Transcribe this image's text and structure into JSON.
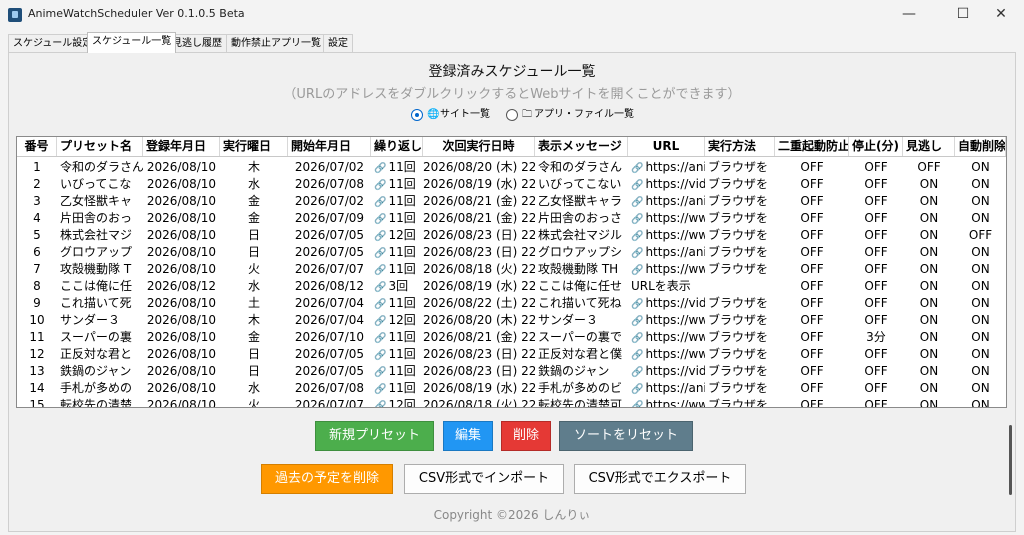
{
  "window": {
    "title": "AnimeWatchScheduler Ver 0.1.0.5 Beta",
    "minimize_glyph": "—",
    "maximize_glyph": "☐",
    "close_glyph": "✕"
  },
  "tabs": [
    "スケジュール設定",
    "スケジュール一覧",
    "見逃し履歴",
    "動作禁止アプリ一覧",
    "設定"
  ],
  "active_tab": 1,
  "heading": "登録済みスケジュール一覧",
  "subheading": "（URLのアドレスをダブルクリックするとWebサイトを開くことができます）",
  "view_options": {
    "site_list": "サイト一覧",
    "app_file_list": "アプリ・ファイル一覧",
    "selected": "site_list"
  },
  "table": {
    "columns": [
      "番号",
      "プリセット名",
      "登録年月日",
      "実行曜日",
      "開始年月日",
      "繰り返し回数",
      "次回実行日時",
      "表示メッセージ",
      "URL",
      "実行方法",
      "二重起動防止",
      "停止(分)",
      "見逃し",
      "自動削除"
    ],
    "rows": [
      [
        "1",
        "令和のダラさん",
        "2026/08/10",
        "木",
        "2026/07/02",
        "11回",
        "2026/08/20 (木) 22",
        "令和のダラさん",
        "https://ani",
        "ブラウザを",
        "OFF",
        "OFF",
        "OFF",
        "ON"
      ],
      [
        "2",
        "いびってこな",
        "2026/08/10",
        "水",
        "2026/07/08",
        "11回",
        "2026/08/19 (水) 22",
        "いびってこない",
        "https://vid",
        "ブラウザを",
        "OFF",
        "OFF",
        "ON",
        "ON"
      ],
      [
        "3",
        "乙女怪獣キャ",
        "2026/08/10",
        "金",
        "2026/07/02",
        "11回",
        "2026/08/21 (金) 22",
        "乙女怪獣キャラ",
        "https://ani",
        "ブラウザを",
        "OFF",
        "OFF",
        "ON",
        "ON"
      ],
      [
        "4",
        "片田舎のおっ",
        "2026/08/10",
        "金",
        "2026/07/09",
        "11回",
        "2026/08/21 (金) 22",
        "片田舎のおっさ",
        "https://ww",
        "ブラウザを",
        "OFF",
        "OFF",
        "ON",
        "ON"
      ],
      [
        "5",
        "株式会社マジ",
        "2026/08/10",
        "日",
        "2026/07/05",
        "12回",
        "2026/08/23 (日) 22",
        "株式会社マジル",
        "https://ww",
        "ブラウザを",
        "OFF",
        "OFF",
        "ON",
        "OFF"
      ],
      [
        "6",
        "グロウアップ",
        "2026/08/10",
        "日",
        "2026/07/05",
        "11回",
        "2026/08/23 (日) 22",
        "グロウアップシ",
        "https://ani",
        "ブラウザを",
        "OFF",
        "OFF",
        "ON",
        "ON"
      ],
      [
        "7",
        "攻殻機動隊 T",
        "2026/08/10",
        "火",
        "2026/07/07",
        "11回",
        "2026/08/18 (火) 22",
        "攻殻機動隊 TH",
        "https://ww",
        "ブラウザを",
        "OFF",
        "OFF",
        "ON",
        "ON"
      ],
      [
        "8",
        "ここは俺に任",
        "2026/08/12",
        "水",
        "2026/08/12",
        "3回",
        "2026/08/19 (水) 22",
        "ここは俺に任せ",
        "URLを表示",
        "",
        "OFF",
        "OFF",
        "ON",
        "ON"
      ],
      [
        "9",
        "これ描いて死",
        "2026/08/10",
        "土",
        "2026/07/04",
        "11回",
        "2026/08/22 (土) 22",
        "これ描いて死ね",
        "https://vid",
        "ブラウザを",
        "OFF",
        "OFF",
        "ON",
        "ON"
      ],
      [
        "10",
        "サンダー３",
        "2026/08/10",
        "木",
        "2026/07/04",
        "12回",
        "2026/08/20 (木) 22",
        "サンダー３",
        "https://ww",
        "ブラウザを",
        "OFF",
        "OFF",
        "ON",
        "ON"
      ],
      [
        "11",
        "スーパーの裏",
        "2026/08/10",
        "金",
        "2026/07/10",
        "11回",
        "2026/08/21 (金) 22",
        "スーパーの裏で",
        "https://ww",
        "ブラウザを",
        "OFF",
        "3分",
        "ON",
        "ON"
      ],
      [
        "12",
        "正反対な君と",
        "2026/08/10",
        "日",
        "2026/07/05",
        "11回",
        "2026/08/23 (日) 22",
        "正反対な君と僕",
        "https://ww",
        "ブラウザを",
        "OFF",
        "OFF",
        "ON",
        "ON"
      ],
      [
        "13",
        "鉄鍋のジャン",
        "2026/08/10",
        "日",
        "2026/07/05",
        "11回",
        "2026/08/23 (日) 22",
        "鉄鍋のジャン",
        "https://vid",
        "ブラウザを",
        "OFF",
        "OFF",
        "ON",
        "ON"
      ],
      [
        "14",
        "手札が多めの",
        "2026/08/10",
        "水",
        "2026/07/08",
        "11回",
        "2026/08/19 (水) 22",
        "手札が多めのビ",
        "https://ani",
        "ブラウザを",
        "OFF",
        "OFF",
        "ON",
        "ON"
      ],
      [
        "15",
        "転校先の清楚",
        "2026/08/10",
        "火",
        "2026/07/07",
        "12回",
        "2026/08/18 (火) 22",
        "転校先の清楚可",
        "https://ww",
        "ブラウザを",
        "OFF",
        "OFF",
        "ON",
        "ON"
      ]
    ]
  },
  "buttons": {
    "new_preset": "新規プリセット",
    "edit": "編集",
    "delete": "削除",
    "reset_sort": "ソートをリセット",
    "delete_past": "過去の予定を削除",
    "csv_import": "CSV形式でインポート",
    "csv_export": "CSV形式でエクスポート"
  },
  "copyright": "Copyright ©2026 しんりぃ",
  "icons": {
    "link": "link-icon",
    "globe": "globe-icon",
    "folder": "folder-icon"
  },
  "colors": {
    "new_preset": "#4cae4c",
    "edit": "#2196f3",
    "delete": "#e53935",
    "reset_sort": "#5f7d8c",
    "delete_past": "#ff9800"
  }
}
